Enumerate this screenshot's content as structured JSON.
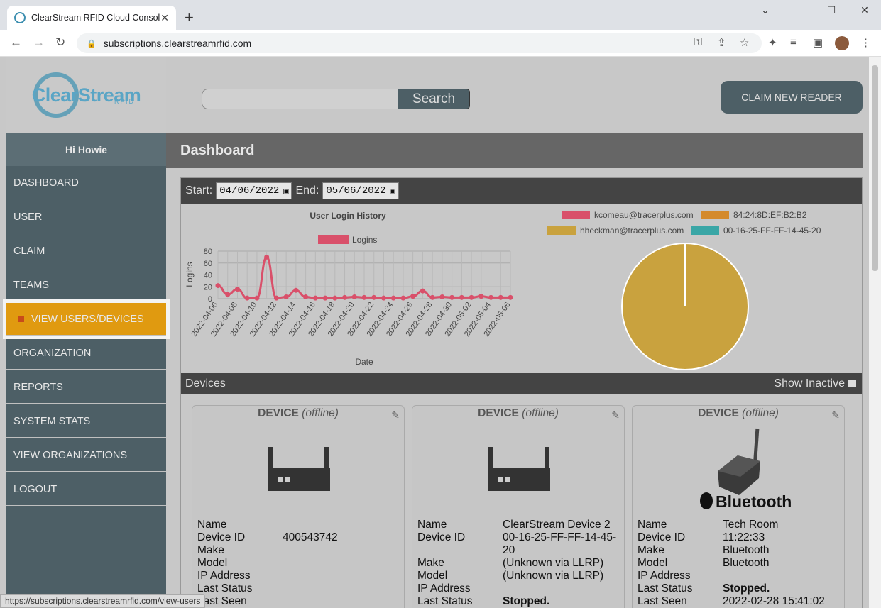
{
  "browser": {
    "tab_title": "ClearStream RFID Cloud Console",
    "tab_close": "✕",
    "new_tab": "+",
    "url": "subscriptions.clearstreamrfid.com",
    "status_url": "https://subscriptions.clearstreamrfid.com/view-users"
  },
  "logo": {
    "word": "ClearStream",
    "sub": "RFID"
  },
  "greeting": "Hi Howie",
  "menu": [
    {
      "label": "DASHBOARD"
    },
    {
      "label": "USER"
    },
    {
      "label": "CLAIM"
    },
    {
      "label": "TEAMS"
    },
    {
      "label": "VIEW USERS/DEVICES",
      "active": true
    },
    {
      "label": "ORGANIZATION"
    },
    {
      "label": "REPORTS"
    },
    {
      "label": "SYSTEM STATS"
    },
    {
      "label": "VIEW ORGANIZATIONS"
    },
    {
      "label": "LOGOUT"
    }
  ],
  "search": {
    "button": "Search",
    "value": ""
  },
  "claim_button": "CLAIM NEW READER",
  "page_title": "Dashboard",
  "dates": {
    "start_label": "Start:",
    "start": "04/06/2022",
    "end_label": "End:",
    "end": "05/06/2022"
  },
  "devices_section": {
    "title": "Devices",
    "show_inactive": "Show Inactive"
  },
  "colors": {
    "accent": "#e09a10",
    "sidebar": "#4d5f66",
    "line": "#d9506a",
    "pie": "#c9a23e"
  },
  "chart_data": [
    {
      "type": "line",
      "title": "User Login History",
      "xlabel": "Date",
      "ylabel": "Logins",
      "ylim": [
        0,
        80
      ],
      "yticks": [
        0,
        20,
        40,
        60,
        80
      ],
      "legend_position": "top",
      "grid": true,
      "x": [
        "2022-04-06",
        "2022-04-07",
        "2022-04-08",
        "2022-04-09",
        "2022-04-10",
        "2022-04-11",
        "2022-04-12",
        "2022-04-13",
        "2022-04-14",
        "2022-04-15",
        "2022-04-16",
        "2022-04-17",
        "2022-04-18",
        "2022-04-19",
        "2022-04-20",
        "2022-04-21",
        "2022-04-22",
        "2022-04-23",
        "2022-04-24",
        "2022-04-25",
        "2022-04-26",
        "2022-04-27",
        "2022-04-28",
        "2022-04-29",
        "2022-04-30",
        "2022-05-01",
        "2022-05-02",
        "2022-05-03",
        "2022-05-04",
        "2022-05-05",
        "2022-05-06"
      ],
      "xtick_labels": [
        "2022-04-06",
        "2022-04-08",
        "2022-04-10",
        "2022-04-12",
        "2022-04-14",
        "2022-04-16",
        "2022-04-18",
        "2022-04-20",
        "2022-04-22",
        "2022-04-24",
        "2022-04-26",
        "2022-04-28",
        "2022-04-30",
        "2022-05-02",
        "2022-05-04",
        "2022-05-06"
      ],
      "series": [
        {
          "name": "Logins",
          "values": [
            22,
            7,
            16,
            1,
            1,
            70,
            1,
            3,
            14,
            3,
            1,
            1,
            1,
            2,
            3,
            2,
            2,
            1,
            1,
            1,
            4,
            13,
            2,
            3,
            2,
            2,
            2,
            4,
            2,
            2,
            2
          ]
        }
      ]
    },
    {
      "type": "pie",
      "legend_position": "top",
      "categories": [
        "kcomeau@tracerplus.com",
        "84:24:8D:EF:B2:B2",
        "hheckman@tracerplus.com",
        "00-16-25-FF-FF-14-45-20"
      ],
      "colors": [
        "#d9506a",
        "#d48a2c",
        "#c9a23e",
        "#3aa6a6"
      ],
      "values": [
        0,
        0,
        100,
        0
      ]
    }
  ],
  "cards": [
    {
      "title": "DEVICE",
      "state": "(offline)",
      "icon": "router-icon",
      "rows": [
        {
          "k": "Name",
          "v": ""
        },
        {
          "k": "Device ID",
          "v": "400543742"
        },
        {
          "k": "Make",
          "v": ""
        },
        {
          "k": "Model",
          "v": ""
        },
        {
          "k": "IP Address",
          "v": ""
        },
        {
          "k": "Last Status",
          "v": ""
        },
        {
          "k": "Last Seen",
          "v": ""
        }
      ]
    },
    {
      "title": "DEVICE",
      "state": "(offline)",
      "icon": "router-icon",
      "rows": [
        {
          "k": "Name",
          "v": "ClearStream Device 2"
        },
        {
          "k": "Device ID",
          "v": "00-16-25-FF-FF-14-45-20"
        },
        {
          "k": "Make",
          "v": "(Unknown via LLRP)"
        },
        {
          "k": "Model",
          "v": "(Unknown via LLRP)"
        },
        {
          "k": "IP Address",
          "v": ""
        },
        {
          "k": "Last Status",
          "v": "Stopped.",
          "bold": true
        }
      ]
    },
    {
      "title": "DEVICE",
      "state": "(offline)",
      "icon": "bluetooth-device-icon",
      "brand": "Bluetooth",
      "rows": [
        {
          "k": "Name",
          "v": "Tech Room"
        },
        {
          "k": "Device ID",
          "v": "11:22:33"
        },
        {
          "k": "Make",
          "v": "Bluetooth"
        },
        {
          "k": "Model",
          "v": "Bluetooth"
        },
        {
          "k": "IP Address",
          "v": ""
        },
        {
          "k": "Last Status",
          "v": "Stopped.",
          "bold": true
        },
        {
          "k": "Last Seen",
          "v": "2022-02-28 15:41:02"
        }
      ]
    }
  ]
}
